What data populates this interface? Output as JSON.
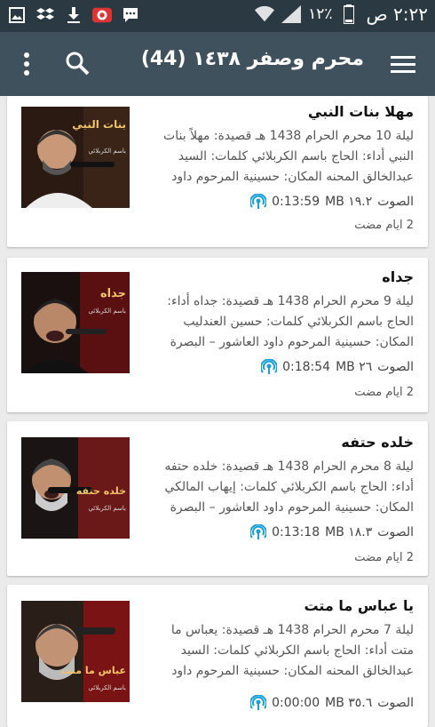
{
  "status_bar": {
    "time": "٢:٢٢ ص",
    "battery": "١٢٪"
  },
  "app_bar": {
    "title": "محرم وصفر ١٤٣٨ (44)"
  },
  "items": [
    {
      "title": "مهلا بنات النبي",
      "desc": "ليلة 10 محرم الحرام 1438 هـ قصيدة: مهلاً بنات النبي أداء: الحاج باسم الكربلائي كلمات: السيد عبدالخالق المحنه المكان: حسينية المرحوم داود",
      "type_label": "الصوت",
      "size": "١٩.٢ MB",
      "duration": "0:13:59",
      "age": "2 ايام مضت"
    },
    {
      "title": "جداه",
      "desc": "ليلة 9 محرم الحرام 1438 هـ قصيدة: جداه أداء: الحاج باسم الكربلائي كلمات: حسين العندليب المكان: حسينية المرحوم داود العاشور – البصرة",
      "type_label": "الصوت",
      "size": "٢٦ MB",
      "duration": "0:18:54",
      "age": "2 ايام مضت"
    },
    {
      "title": "خلده حتفه",
      "desc": "ليلة 8 محرم الحرام 1438 هـ قصيدة: خلده حتفه أداء: الحاج باسم الكربلائي كلمات: إيهاب المالكي المكان: حسينية المرحوم داود العاشور – البصرة",
      "type_label": "الصوت",
      "size": "١٨.٣ MB",
      "duration": "0:13:18",
      "age": "2 ايام مضت"
    },
    {
      "title": "يا عباس ما متت",
      "desc": "ليلة 7 محرم الحرام 1438 هـ قصيدة: يعباس ما متت أداء: الحاج باسم الكربلائي كلمات: السيد عبدالخالق المحنه المكان: حسينية المرحوم داود",
      "type_label": "الصوت",
      "size": "٣٥.٦ MB",
      "duration": "0:00:00",
      "age": ""
    }
  ],
  "colors": {
    "status_bar": "#2b3a42",
    "app_bar": "#3f515c",
    "podcast_icon": "#1aa0d8"
  }
}
